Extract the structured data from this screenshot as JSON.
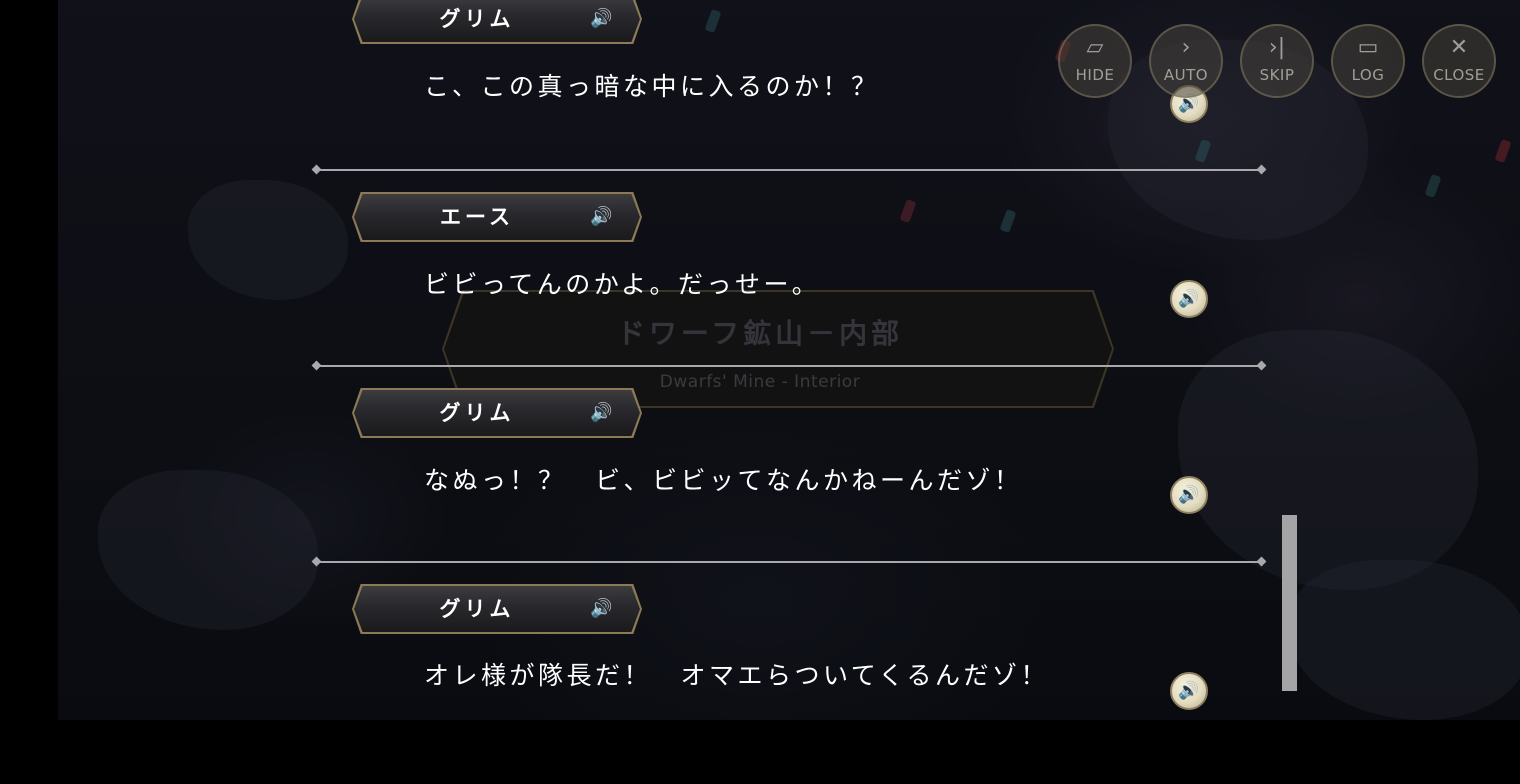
{
  "location": {
    "title": "ドワーフ鉱山－内部",
    "subtitle": "Dwarfs' Mine - Interior"
  },
  "menu": [
    {
      "label": "HIDE",
      "icon": "hide-icon",
      "glyph": "▱"
    },
    {
      "label": "AUTO",
      "icon": "auto-icon",
      "glyph": "›"
    },
    {
      "label": "SKIP",
      "icon": "skip-icon",
      "glyph": "›|"
    },
    {
      "label": "LOG",
      "icon": "log-icon",
      "glyph": "▭"
    },
    {
      "label": "CLOSE",
      "icon": "close-icon",
      "glyph": "✕"
    }
  ],
  "log": [
    {
      "speaker": "グリム",
      "text": "こ、この真っ暗な中に入るのか！？"
    },
    {
      "speaker": "エース",
      "text": "ビビってんのかよ。だっせー。"
    },
    {
      "speaker": "グリム",
      "text": "なぬっ！？　ビ、ビビッてなんかねーんだゾ！"
    },
    {
      "speaker": "グリム",
      "text": "オレ様が隊長だ！　オマエらついてくるんだゾ！"
    }
  ],
  "glyphs": {
    "speaker_voice": "🔊",
    "voice_button": "🔊"
  },
  "colors": {
    "accent_gold": "#8b7a55",
    "divider": "#a9a9ad"
  }
}
